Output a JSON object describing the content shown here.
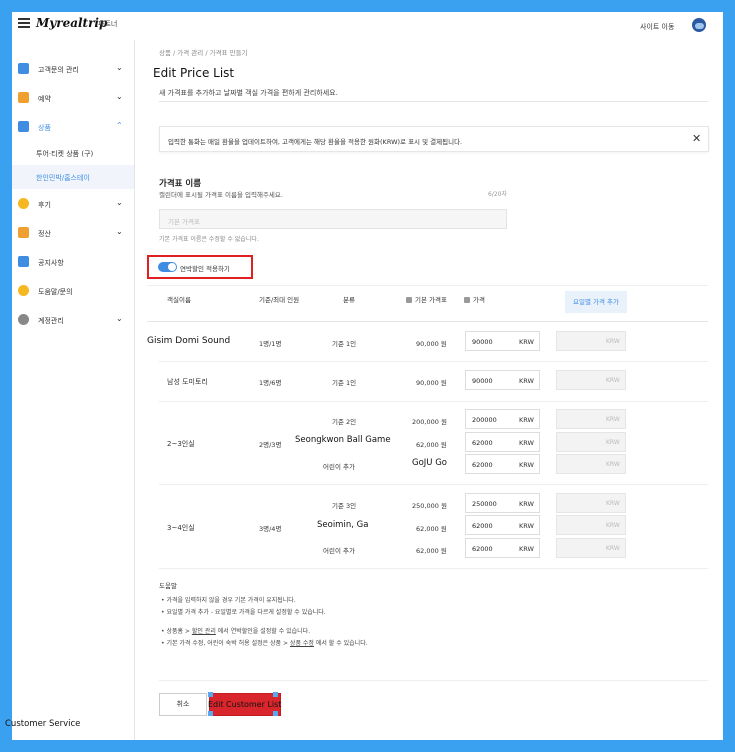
{
  "topbar": {
    "logo": "Myrealtrip",
    "partner": "파트너",
    "site_move": "사이트 이동"
  },
  "sidebar": {
    "items": [
      {
        "label": "고객문의 관리",
        "icon": "chat-icon",
        "color": "#3f8de3"
      },
      {
        "label": "예약",
        "icon": "calendar-icon",
        "color": "#f0a030"
      },
      {
        "label": "상품",
        "icon": "grid-icon",
        "color": "#3f8de3"
      },
      {
        "label": "후기",
        "icon": "star-icon",
        "color": "#f5b820"
      },
      {
        "label": "정산",
        "icon": "dashboard-icon",
        "color": "#f0a030"
      },
      {
        "label": "공지사항",
        "icon": "megaphone-icon",
        "color": "#3f8de3"
      },
      {
        "label": "도움말/문의",
        "icon": "question-icon",
        "color": "#f5b820"
      },
      {
        "label": "계정관리",
        "icon": "gear-icon",
        "color": "#888888"
      }
    ],
    "sub_items": [
      {
        "label": "투어·티켓 상품 (구)"
      },
      {
        "label": "한인민박/홈스테이"
      }
    ]
  },
  "main": {
    "breadcrumb": "상품 / 가격 관리 / 가격표 만들기",
    "title": "Edit Price List",
    "subtitle": "새 가격표를 추가하고 날짜별 객실 가격을 편하게 관리하세요.",
    "notice": "입력한 통화는 매일 환율을 업데이트하여, 고객에게는 해당 환율을 적용한 원화(KRW)로 표시 및 결제됩니다.",
    "name_section": {
      "title": "가격표 이름",
      "desc": "캘린더에 표시될 가격표 이름을 입력해주세요.",
      "counter": "6/20자",
      "placeholder": "기본 가격표",
      "hint": "기본 가격표 이름은 수정할 수 없습니다."
    },
    "toggle_label": "연박할인 적용하기",
    "table": {
      "headers": {
        "room": "객실이름",
        "capacity": "기준/최대 인원",
        "category": "분류",
        "base_price": "기본 가격표",
        "price": "가격",
        "day_button": "요일별 가격 추가"
      },
      "currency": "KRW",
      "rows": [
        {
          "room": "Gisim Domi Sound",
          "capacity": "1명/1명",
          "category": "기준 1인",
          "base": "90,000 원",
          "price": "90000"
        },
        {
          "room": "남성 도미토리",
          "capacity": "1명/6명",
          "category": "기준 1인",
          "base": "90,000 원",
          "price": "90000"
        },
        {
          "room": "2~3인실",
          "capacity": "2명/3명",
          "category": "기준 2인",
          "base": "200,000 원",
          "price": "200000"
        },
        {
          "room": "",
          "capacity": "",
          "category": "",
          "base": "62,000 원",
          "price": "62000"
        },
        {
          "room": "",
          "capacity": "",
          "category": "어린이 추가",
          "base": "",
          "price": "62000"
        },
        {
          "room": "3~4인실",
          "capacity": "3명/4명",
          "category": "기준 3인",
          "base": "250,000 원",
          "price": "250000"
        },
        {
          "room": "",
          "capacity": "",
          "category": "",
          "base": "62,000 원",
          "price": "62000"
        },
        {
          "room": "",
          "capacity": "",
          "category": "어린이 추가",
          "base": "62,000 원",
          "price": "62000"
        }
      ],
      "overlay_labels": {
        "seongkwon": "Seongkwon Ball Game",
        "goju": "GoJU Go",
        "seoimin": "Seoimin, Ga"
      }
    },
    "help": {
      "title": "도움말",
      "lines": [
        "가격을 입력하지 않을 경우 기본 가격이 유지됩니다.",
        "요일별 가격 추가 - 요일별로 가격을 다르게 설정할 수 있습니다."
      ],
      "line3_prefix": "상품홈 > ",
      "line3_link": "할인 관리",
      "line3_suffix": " 에서 연박할인을 설정할 수 있습니다.",
      "line4_prefix": "기본 가격 수정, 어린이 숙박 허용 설정은 상품 > ",
      "line4_link": "상품 수정",
      "line4_suffix": " 에서 할 수 있습니다."
    },
    "buttons": {
      "cancel": "취소",
      "save": "Edit Customer List"
    }
  },
  "footer_label": "Customer Service",
  "colors": {
    "frame_border": "#3aa0f0",
    "accent": "#3f8de3",
    "save_button": "#d9262c",
    "highlight_box": "#e02020"
  }
}
